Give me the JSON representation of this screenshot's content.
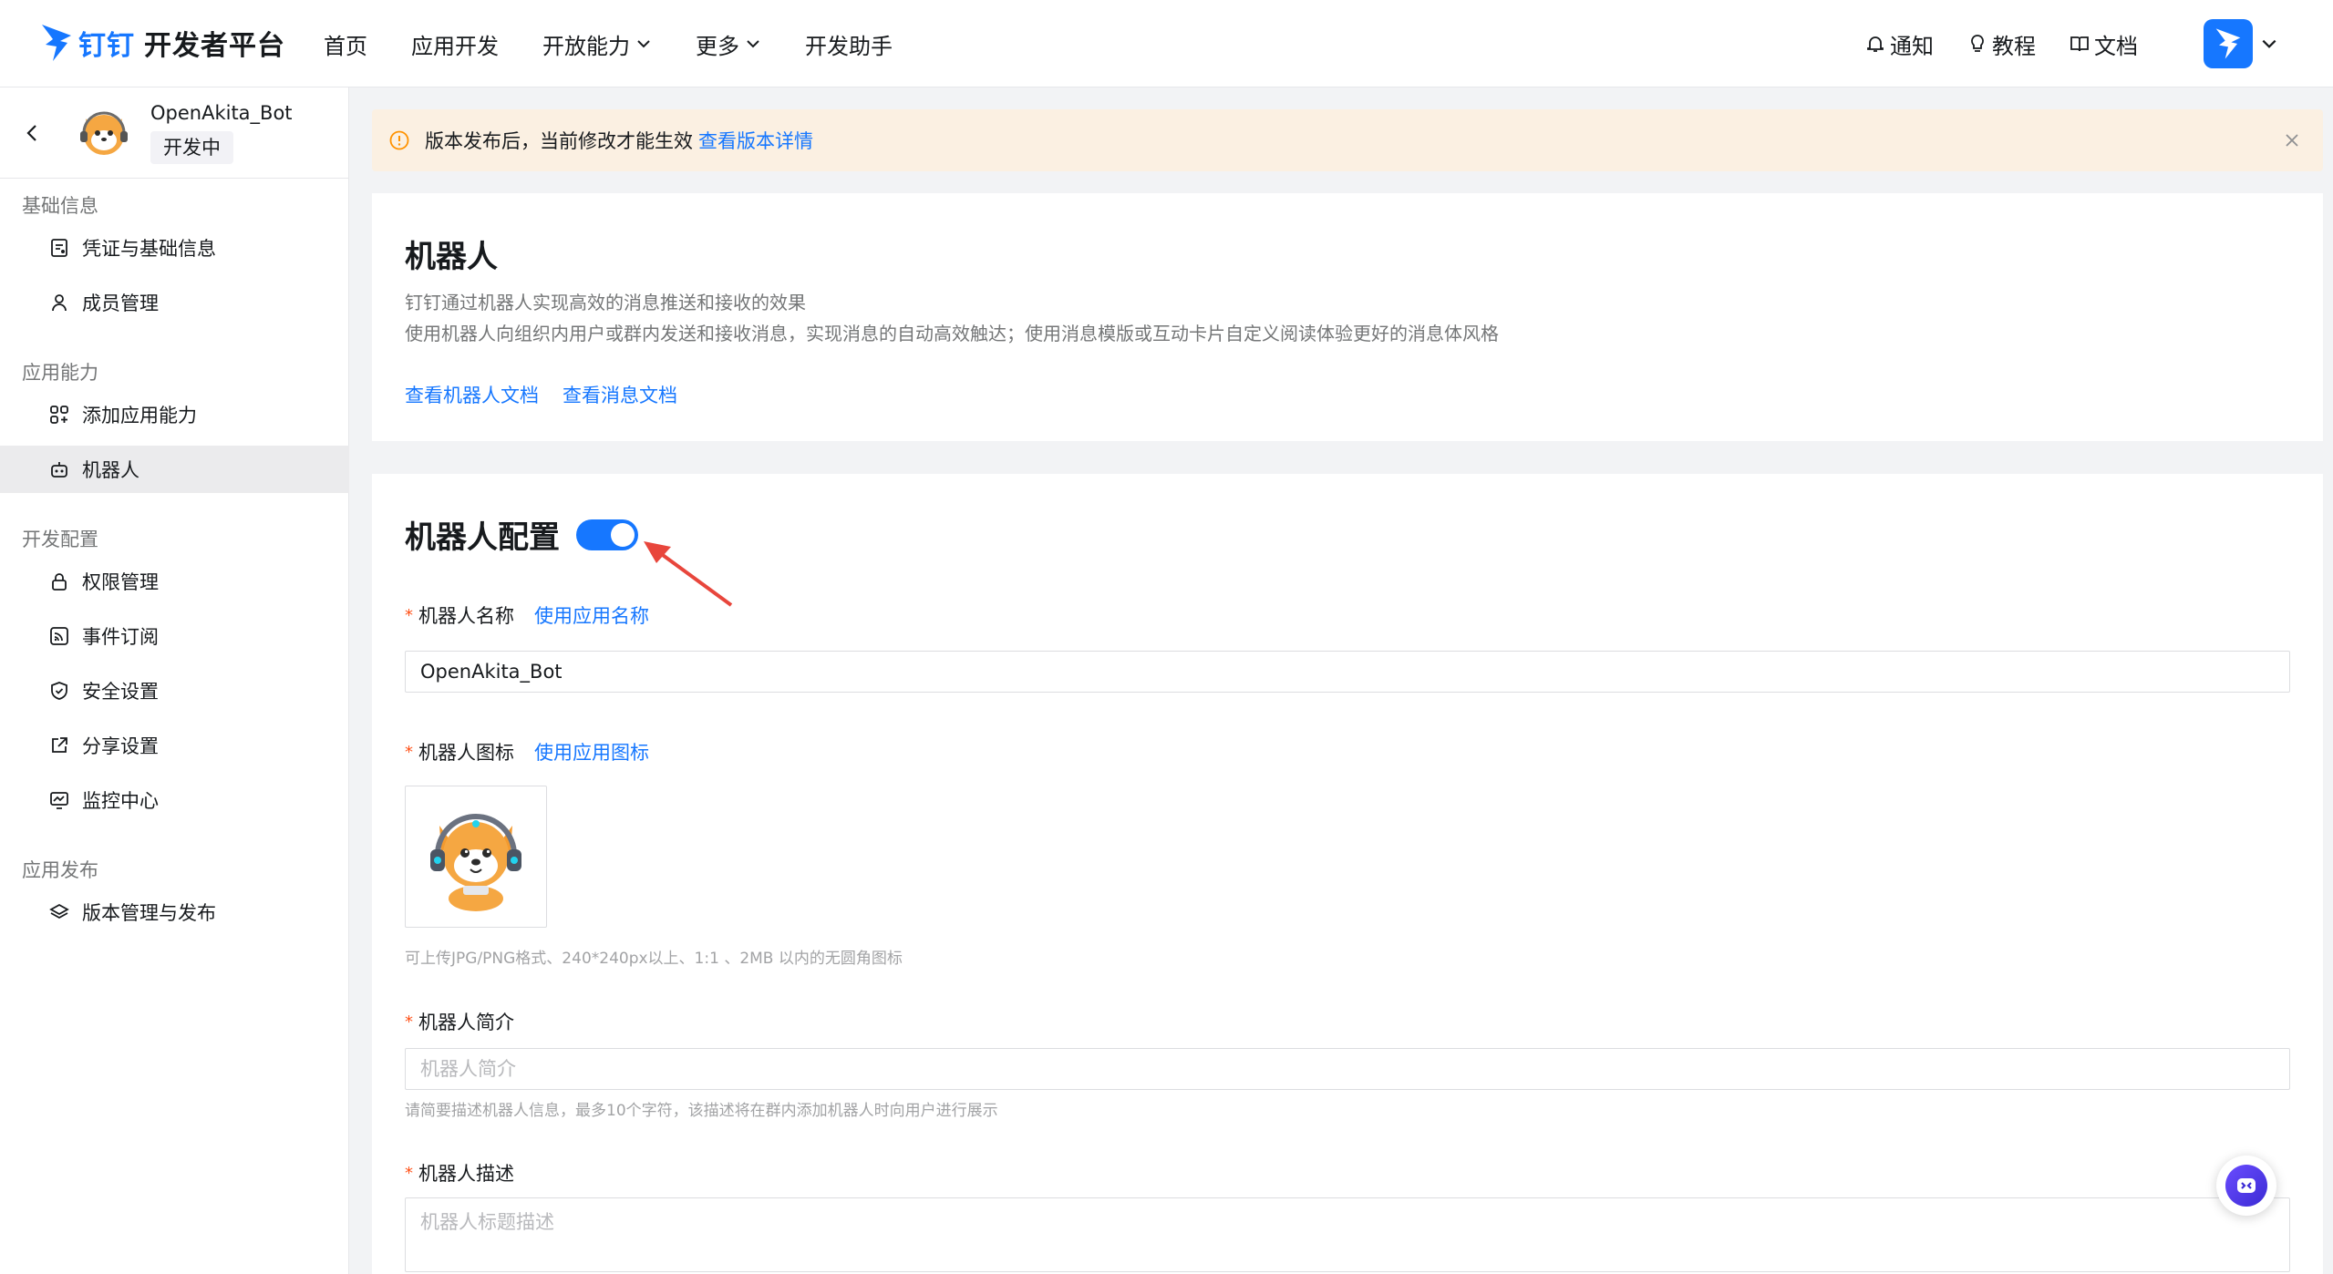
{
  "brand": {
    "prefix": "钉钉",
    "name": "开发者平台"
  },
  "nav": {
    "items": [
      {
        "label": "首页",
        "dropdown": false
      },
      {
        "label": "应用开发",
        "dropdown": false
      },
      {
        "label": "开放能力",
        "dropdown": true
      },
      {
        "label": "更多",
        "dropdown": true
      },
      {
        "label": "开发助手",
        "dropdown": false
      }
    ]
  },
  "right_nav": {
    "notify": "通知",
    "tutorial": "教程",
    "docs": "文档"
  },
  "app": {
    "name": "OpenAkita_Bot",
    "status": "开发中"
  },
  "sidebar": {
    "groups": [
      {
        "label": "基础信息",
        "items": [
          {
            "label": "凭证与基础信息",
            "icon": "credential-icon"
          },
          {
            "label": "成员管理",
            "icon": "user-icon"
          }
        ]
      },
      {
        "label": "应用能力",
        "items": [
          {
            "label": "添加应用能力",
            "icon": "apps-icon"
          },
          {
            "label": "机器人",
            "icon": "robot-icon",
            "active": true
          }
        ]
      },
      {
        "label": "开发配置",
        "items": [
          {
            "label": "权限管理",
            "icon": "lock-icon"
          },
          {
            "label": "事件订阅",
            "icon": "rss-icon"
          },
          {
            "label": "安全设置",
            "icon": "shield-icon"
          },
          {
            "label": "分享设置",
            "icon": "share-icon"
          },
          {
            "label": "监控中心",
            "icon": "monitor-icon"
          }
        ]
      },
      {
        "label": "应用发布",
        "items": [
          {
            "label": "版本管理与发布",
            "icon": "layers-icon"
          }
        ]
      }
    ]
  },
  "alert": {
    "text": "版本发布后，当前修改才能生效",
    "link": "查看版本详情"
  },
  "robot_intro": {
    "title": "机器人",
    "desc1": "钉钉通过机器人实现高效的消息推送和接收的效果",
    "desc2": "使用机器人向组织内用户或群内发送和接收消息，实现消息的自动高效触达；使用消息模版或互动卡片自定义阅读体验更好的消息体风格",
    "links": [
      "查看机器人文档",
      "查看消息文档"
    ]
  },
  "robot_config": {
    "title": "机器人配置",
    "enabled": true,
    "name_label": "机器人名称",
    "name_link": "使用应用名称",
    "name_value": "OpenAkita_Bot",
    "icon_label": "机器人图标",
    "icon_link": "使用应用图标",
    "icon_hint": "可上传JPG/PNG格式、240*240px以上、1:1 、2MB 以内的无圆角图标",
    "intro_label": "机器人简介",
    "intro_placeholder": "机器人简介",
    "intro_hint": "请简要描述机器人信息，最多10个字符，该描述将在群内添加机器人时向用户进行展示",
    "desc_label": "机器人描述",
    "desc_placeholder": "机器人标题描述"
  },
  "colors": {
    "accent": "#1677ff",
    "required": "#ff5219",
    "alert_bg": "#fbf0e2"
  }
}
